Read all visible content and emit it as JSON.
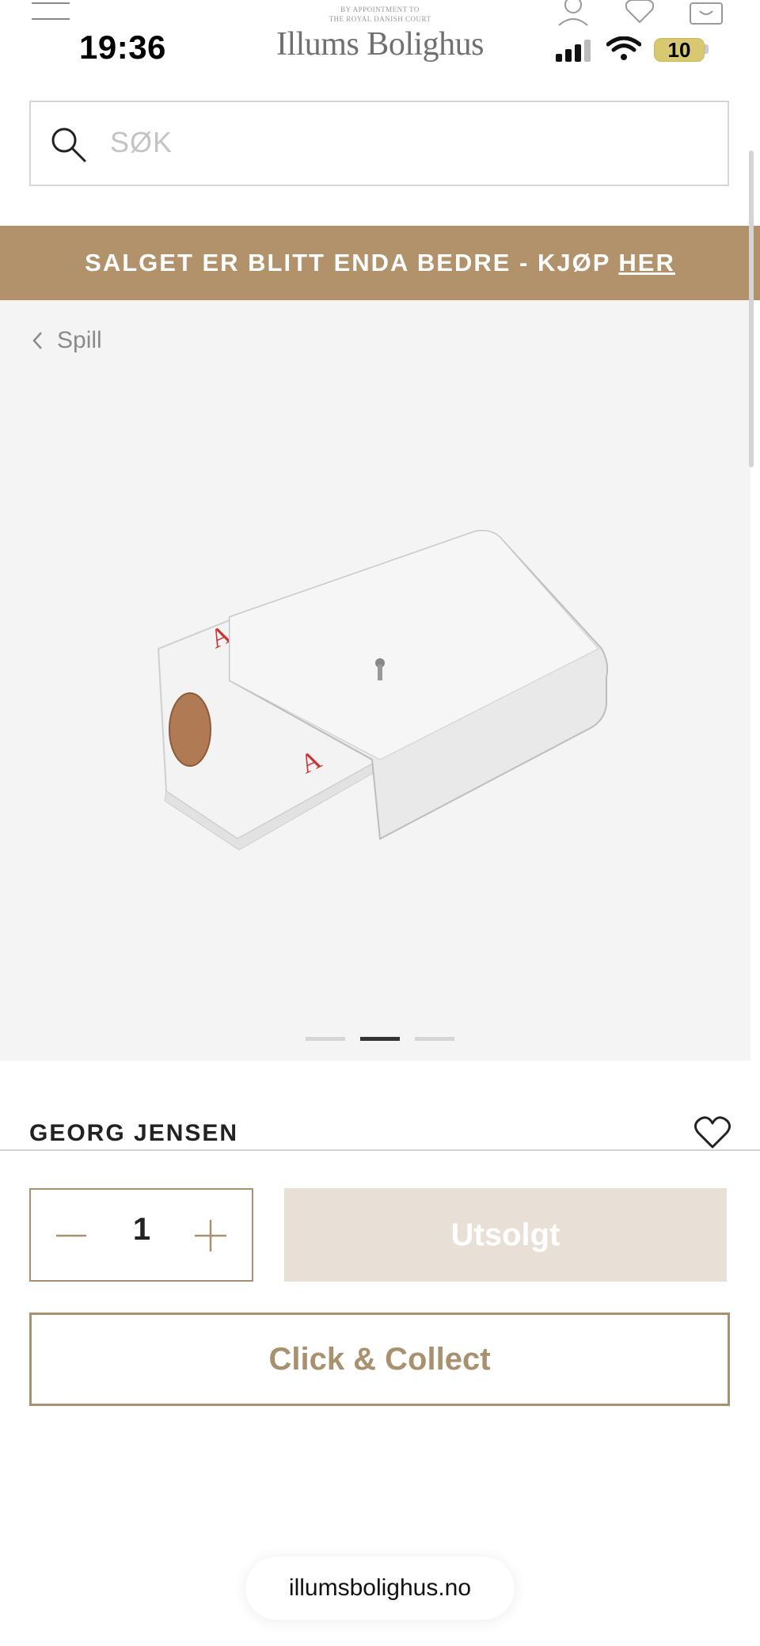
{
  "status_bar": {
    "time": "19:36",
    "battery": "10"
  },
  "header": {
    "logo_small_line1": "BY APPOINTMENT TO",
    "logo_small_line2": "THE ROYAL DANISH COURT",
    "logo": "Illums Bolighus",
    "icons": [
      "menu-icon",
      "user-icon",
      "heart-icon",
      "bag-icon"
    ]
  },
  "search": {
    "placeholder": "SØK"
  },
  "promo": {
    "text": "SALGET ER BLITT ENDA BEDRE - KJØP",
    "link": "HER"
  },
  "breadcrumb": {
    "label": "Spill"
  },
  "gallery": {
    "count": 3,
    "active_index": 1
  },
  "product": {
    "brand": "GEORG JENSEN"
  },
  "purchase": {
    "quantity": "1",
    "soldout_label": "Utsolgt",
    "collect_label": "Click & Collect"
  },
  "browser": {
    "url": "illumsbolighus.no"
  },
  "colors": {
    "accent": "#b1926a",
    "accent_border": "#a99170",
    "soldout_bg": "#e8e0d6",
    "product_bg": "#f4f4f4"
  }
}
